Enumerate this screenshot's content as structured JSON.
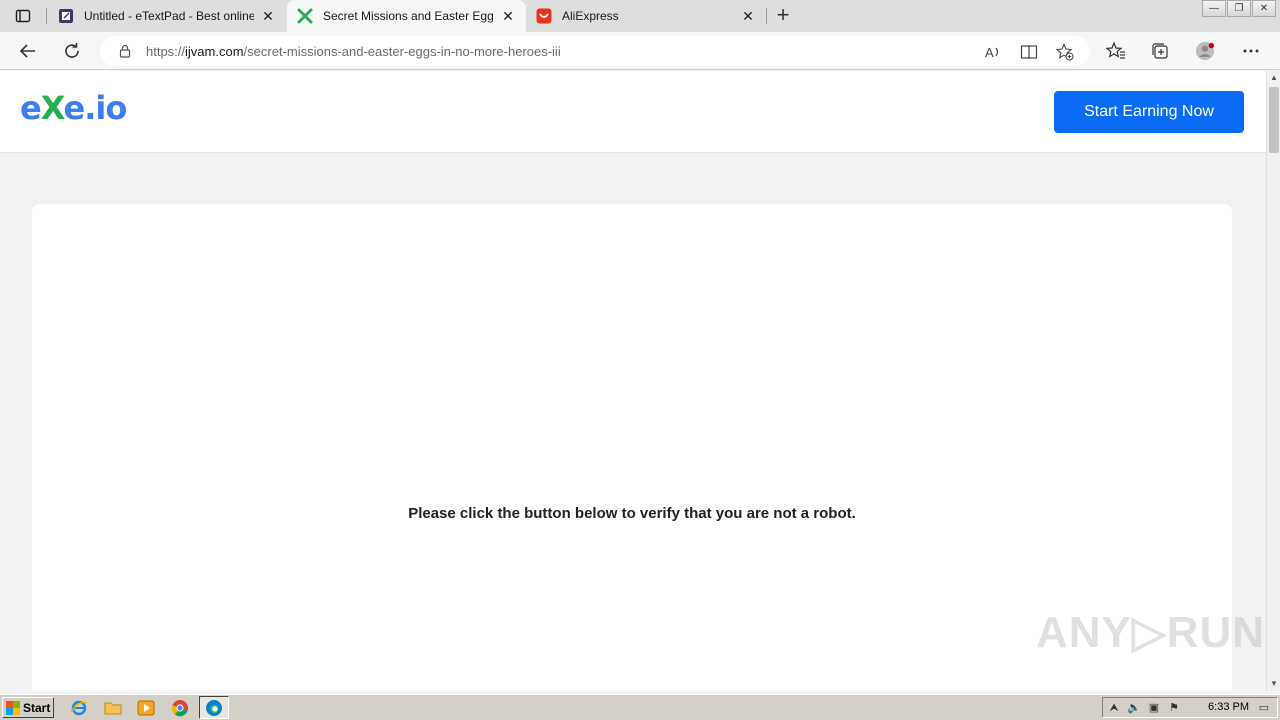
{
  "browser": {
    "tabs": [
      {
        "title": "Untitled - eTextPad - Best online Notepad",
        "active": false
      },
      {
        "title": "Secret Missions and Easter Eggs in No More Heroes III",
        "active": true
      },
      {
        "title": "AliExpress",
        "active": false
      }
    ],
    "close_glyph": "✕",
    "new_tab_glyph": "+",
    "url_scheme": "https://",
    "url_host": "ijvam.com",
    "url_path": "/secret-missions-and-easter-eggs-in-no-more-heroes-iii",
    "window_buttons": [
      "—",
      "❐",
      "✕"
    ]
  },
  "site": {
    "logo_part1": "e",
    "logo_part2": "X",
    "logo_part3": "e.io",
    "cta_label": "Start Earning Now",
    "verify_text": "Please click the button below to verify that you are not a robot.",
    "watermark": "ANY▷RUN"
  },
  "taskbar": {
    "start_label": "Start",
    "clock": "6:33 PM"
  },
  "colors": {
    "accent": "#0a6cf5",
    "logo_blue": "#3d7ff0",
    "logo_green": "#23b14d"
  }
}
